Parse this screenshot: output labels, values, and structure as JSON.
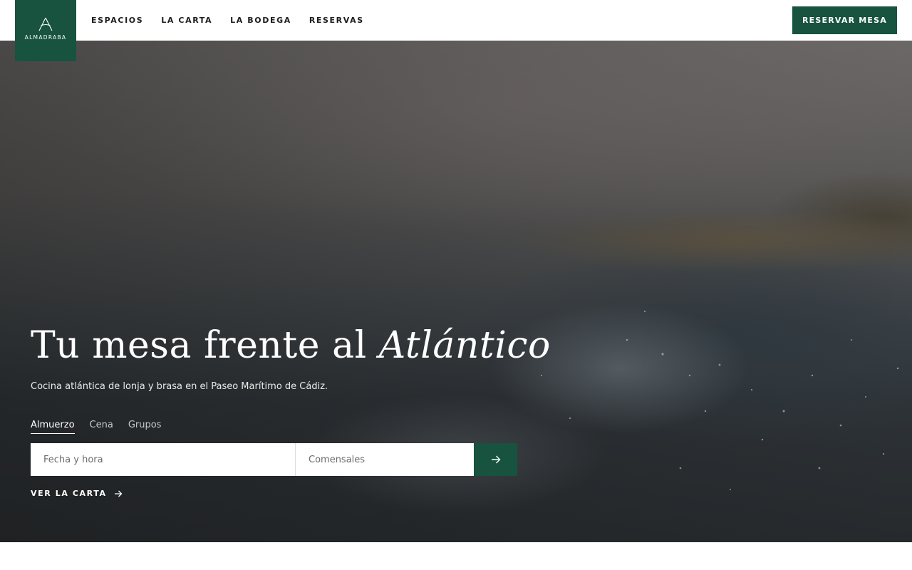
{
  "header": {
    "logo_text": "ALMADRABA",
    "nav": [
      "ESPACIOS",
      "LA CARTA",
      "LA BODEGA",
      "RESERVAS"
    ],
    "cta_label": "RESERVAR MESA"
  },
  "hero": {
    "title_main": "Tu mesa frente al ",
    "title_italic": "Atlántico",
    "subtitle": "Cocina atlántica de lonja y brasa en el Paseo Marítimo de Cádiz.",
    "tabs": [
      "Almuerzo",
      "Cena",
      "Grupos"
    ],
    "active_tab": "Almuerzo",
    "date_placeholder": "Fecha y hora",
    "guests_placeholder": "Comensales",
    "submit_icon": "arrow-right-icon",
    "menu_link_label": "VER LA CARTA",
    "menu_link_icon": "arrow-right-icon"
  },
  "colors": {
    "brand": "#17533f",
    "header_bg": "#ffffff",
    "hero_text": "#ffffff"
  }
}
